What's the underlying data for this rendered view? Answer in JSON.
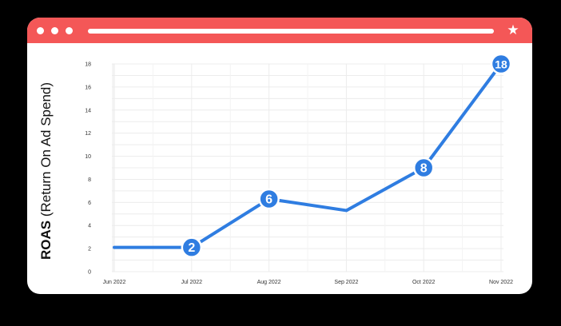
{
  "window": {
    "titlebar_color": "#f45757",
    "star_icon": "★"
  },
  "chart_data": {
    "type": "line",
    "ylabel_bold": "ROAS",
    "ylabel_rest": " (Return On Ad Spend)",
    "ylim": [
      0,
      18
    ],
    "y_ticks": [
      "0",
      "2",
      "4",
      "6",
      "8",
      "10",
      "12",
      "14",
      "16",
      "18"
    ],
    "categories": [
      "Jun 2022",
      "Jul 2022",
      "Aug 2022",
      "Sep 2022",
      "Oct 2022",
      "Nov 2022"
    ],
    "values": [
      2.1,
      2.1,
      6.3,
      5.3,
      9.0,
      18.0
    ],
    "point_labels": [
      "",
      "2",
      "6",
      "",
      "8",
      "18"
    ],
    "grid": true,
    "line_color": "#2f7de1"
  }
}
